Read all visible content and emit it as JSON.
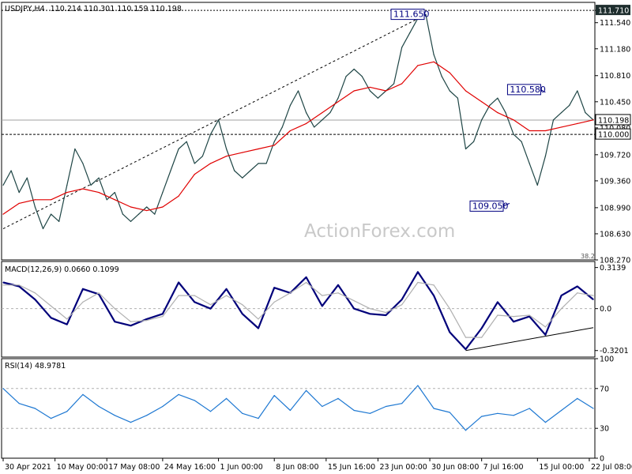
{
  "chart_data": [
    {
      "type": "line",
      "panel": "price",
      "title": "USDJPY,H4",
      "ohlc_text": "110.214 110.301 110.159 110.198",
      "watermark": "ActionForex.com",
      "ylim": [
        108.27,
        111.82
      ],
      "y_ticks": [
        111.71,
        111.54,
        111.18,
        110.81,
        110.45,
        110.09,
        109.72,
        109.36,
        108.99,
        108.63,
        108.27
      ],
      "y_tick_labels": [
        "111.710",
        "111.540",
        "111.180",
        "110.810",
        "110.450",
        "110.080",
        "109.720",
        "109.360",
        "108.990",
        "108.630",
        "108.270"
      ],
      "small_label": "38.2",
      "current_price": 110.198,
      "current_price_label": "110.198",
      "level_line": 110.0,
      "level_line_label": "110.000",
      "top_line": 111.71,
      "callouts": [
        {
          "label": "111.650",
          "x": 106,
          "y": 111.65
        },
        {
          "label": "110.580",
          "x": 136,
          "y": 110.58
        },
        {
          "label": "109.050",
          "x": 127,
          "y": 109.05
        }
      ],
      "trendline": {
        "x": [
          0,
          106
        ],
        "y": [
          108.7,
          111.65
        ]
      },
      "series": [
        {
          "name": "price",
          "color": "#1e4545",
          "x": [
            0,
            2,
            4,
            6,
            8,
            10,
            12,
            14,
            16,
            18,
            20,
            22,
            24,
            26,
            28,
            30,
            32,
            34,
            36,
            38,
            40,
            42,
            44,
            46,
            48,
            50,
            52,
            54,
            56,
            58,
            60,
            62,
            64,
            66,
            68,
            70,
            72,
            74,
            76,
            78,
            80,
            82,
            84,
            86,
            88,
            90,
            92,
            94,
            96,
            98,
            100,
            102,
            104,
            106,
            108,
            110,
            112,
            114,
            116,
            118,
            120,
            122,
            124,
            126,
            128,
            130,
            132,
            134,
            136,
            138,
            140,
            142,
            144,
            146,
            148
          ],
          "values": [
            109.3,
            109.5,
            109.2,
            109.4,
            109.0,
            108.7,
            108.9,
            108.8,
            109.3,
            109.8,
            109.6,
            109.3,
            109.4,
            109.1,
            109.2,
            108.9,
            108.8,
            108.9,
            109.0,
            108.9,
            109.2,
            109.5,
            109.8,
            109.9,
            109.6,
            109.7,
            110.0,
            110.2,
            109.8,
            109.5,
            109.4,
            109.5,
            109.6,
            109.6,
            109.9,
            110.1,
            110.4,
            110.6,
            110.3,
            110.1,
            110.2,
            110.3,
            110.5,
            110.8,
            110.9,
            110.8,
            110.6,
            110.5,
            110.6,
            110.7,
            111.2,
            111.4,
            111.6,
            111.65,
            111.1,
            110.8,
            110.6,
            110.5,
            109.8,
            109.9,
            110.2,
            110.4,
            110.5,
            110.3,
            110.0,
            109.9,
            109.6,
            109.3,
            109.7,
            110.2,
            110.3,
            110.4,
            110.6,
            110.3,
            110.2
          ]
        },
        {
          "name": "ma",
          "color": "#e00000",
          "x": [
            0,
            4,
            8,
            12,
            16,
            20,
            24,
            28,
            32,
            36,
            40,
            44,
            48,
            52,
            56,
            60,
            64,
            68,
            72,
            76,
            80,
            84,
            88,
            92,
            96,
            100,
            104,
            108,
            112,
            116,
            120,
            124,
            128,
            132,
            136,
            140,
            144,
            148
          ],
          "values": [
            108.9,
            109.05,
            109.1,
            109.1,
            109.2,
            109.25,
            109.2,
            109.1,
            109.0,
            108.95,
            109.0,
            109.15,
            109.45,
            109.6,
            109.7,
            109.75,
            109.8,
            109.85,
            110.05,
            110.15,
            110.3,
            110.45,
            110.6,
            110.65,
            110.6,
            110.7,
            110.95,
            111.0,
            110.85,
            110.6,
            110.45,
            110.3,
            110.2,
            110.05,
            110.05,
            110.1,
            110.15,
            110.2
          ]
        }
      ]
    },
    {
      "type": "line",
      "panel": "macd",
      "title": "MACD(12,26,9) 0.0660 0.1099",
      "ylim": [
        -0.37,
        0.36
      ],
      "y_ticks": [
        0.3139,
        0.0,
        -0.3201
      ],
      "y_tick_labels": [
        "0.3139",
        "0.0",
        "-0.3201"
      ],
      "trendline": {
        "x": [
          116,
          148
        ],
        "y": [
          -0.32,
          -0.145
        ]
      },
      "series": [
        {
          "name": "macd",
          "color": "#00007a",
          "x": [
            0,
            4,
            8,
            12,
            16,
            20,
            24,
            28,
            32,
            36,
            40,
            44,
            48,
            52,
            56,
            60,
            64,
            68,
            72,
            76,
            80,
            84,
            88,
            92,
            96,
            100,
            104,
            108,
            112,
            116,
            120,
            124,
            128,
            132,
            136,
            140,
            144,
            148
          ],
          "values": [
            0.2,
            0.17,
            0.07,
            -0.07,
            -0.12,
            0.15,
            0.11,
            -0.1,
            -0.13,
            -0.08,
            -0.04,
            0.2,
            0.05,
            0.0,
            0.15,
            -0.04,
            -0.15,
            0.16,
            0.12,
            0.24,
            0.02,
            0.18,
            0.0,
            -0.04,
            -0.05,
            0.07,
            0.28,
            0.1,
            -0.18,
            -0.31,
            -0.15,
            0.05,
            -0.1,
            -0.06,
            -0.2,
            0.1,
            0.17,
            0.07
          ]
        },
        {
          "name": "signal",
          "color": "#b0b0b0",
          "x": [
            0,
            4,
            8,
            12,
            16,
            20,
            24,
            28,
            32,
            36,
            40,
            44,
            48,
            52,
            56,
            60,
            64,
            68,
            72,
            76,
            80,
            84,
            88,
            92,
            96,
            100,
            104,
            108,
            112,
            116,
            120,
            124,
            128,
            132,
            136,
            140,
            144,
            148
          ],
          "values": [
            0.18,
            0.18,
            0.12,
            0.02,
            -0.08,
            0.05,
            0.12,
            0.0,
            -0.1,
            -0.09,
            -0.06,
            0.1,
            0.1,
            0.03,
            0.1,
            0.03,
            -0.08,
            0.05,
            0.12,
            0.2,
            0.1,
            0.12,
            0.06,
            0.0,
            -0.03,
            0.03,
            0.2,
            0.18,
            0.0,
            -0.22,
            -0.22,
            -0.05,
            -0.06,
            -0.05,
            -0.14,
            0.0,
            0.12,
            0.1
          ]
        }
      ]
    },
    {
      "type": "line",
      "panel": "rsi",
      "title": "RSI(14) 48.9781",
      "ylim": [
        0,
        100
      ],
      "y_ticks": [
        100,
        70,
        30,
        0
      ],
      "y_tick_labels": [
        "100",
        "70",
        "30",
        "0"
      ],
      "levels": [
        70,
        30
      ],
      "series": [
        {
          "name": "rsi",
          "color": "#1e78d2",
          "x": [
            0,
            4,
            8,
            12,
            16,
            20,
            24,
            28,
            32,
            36,
            40,
            44,
            48,
            52,
            56,
            60,
            64,
            68,
            72,
            76,
            80,
            84,
            88,
            92,
            96,
            100,
            104,
            108,
            112,
            116,
            120,
            124,
            128,
            132,
            136,
            140,
            144,
            148
          ],
          "values": [
            70,
            55,
            50,
            40,
            47,
            64,
            52,
            43,
            36,
            43,
            52,
            64,
            58,
            47,
            60,
            45,
            40,
            63,
            48,
            68,
            52,
            60,
            48,
            45,
            52,
            55,
            73,
            50,
            46,
            28,
            42,
            45,
            43,
            50,
            36,
            48,
            60,
            50
          ]
        }
      ]
    }
  ],
  "x_axis": {
    "range": [
      0,
      148
    ],
    "ticks": [
      0,
      13,
      26,
      40,
      54,
      68,
      81,
      94,
      107,
      120,
      134,
      147
    ],
    "labels": [
      "30 Apr 2021",
      "10 May 00:00",
      "17 May 08:00",
      "24 May 16:00",
      "1 Jun 00:00",
      "8 Jun 08:00",
      "15 Jun 16:00",
      "23 Jun 00:00",
      "30 Jun 08:00",
      "7 Jul 16:00",
      "15 Jul 00:00",
      "22 Jul 08:00"
    ]
  }
}
